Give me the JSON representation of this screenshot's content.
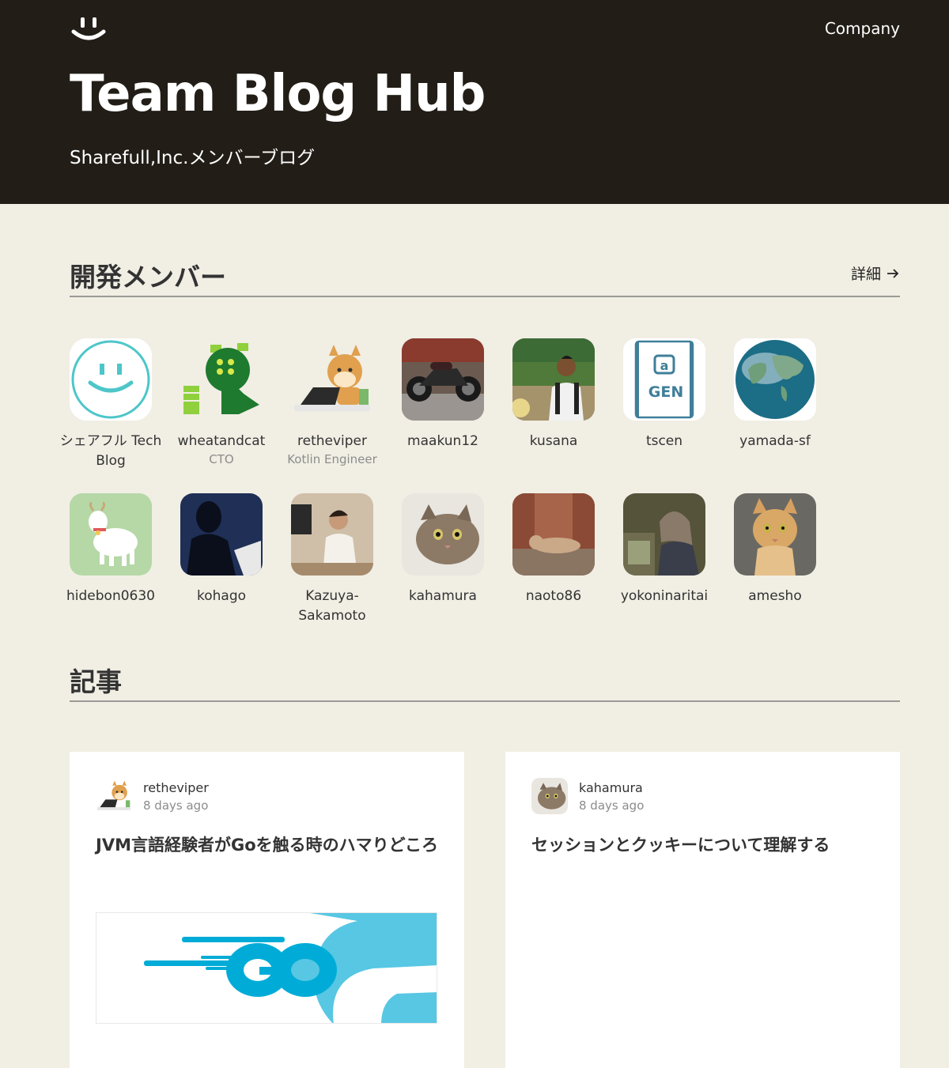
{
  "header": {
    "title": "Team Blog Hub",
    "subtitle": "Sharefull,Inc.メンバーブログ",
    "nav_link": "Company",
    "logo_icon": "smile-icon"
  },
  "members_section": {
    "title": "開発メンバー",
    "detail_link": "詳細",
    "members": [
      {
        "name": "シェアフル Tech Blog",
        "role": ""
      },
      {
        "name": "wheatandcat",
        "role": "CTO"
      },
      {
        "name": "retheviper",
        "role": "Kotlin Engineer"
      },
      {
        "name": "maakun12",
        "role": ""
      },
      {
        "name": "kusana",
        "role": ""
      },
      {
        "name": "tscen",
        "role": ""
      },
      {
        "name": "yamada-sf",
        "role": ""
      },
      {
        "name": "hidebon0630",
        "role": ""
      },
      {
        "name": "kohago",
        "role": ""
      },
      {
        "name": "Kazuya-Sakamoto",
        "role": ""
      },
      {
        "name": "kahamura",
        "role": ""
      },
      {
        "name": "naoto86",
        "role": ""
      },
      {
        "name": "yokoninaritai",
        "role": ""
      },
      {
        "name": "amesho",
        "role": ""
      }
    ]
  },
  "articles_section": {
    "title": "記事",
    "articles": [
      {
        "author": "retheviper",
        "time": "8 days ago",
        "title": "JVM言語経験者がGoを触る時のハマりどころ"
      },
      {
        "author": "kahamura",
        "time": "8 days ago",
        "title": "セッションとクッキーについて理解する"
      }
    ]
  },
  "colors": {
    "header_bg": "#221e17",
    "page_bg": "#f1eee4",
    "go_blue": "#00acd7"
  }
}
